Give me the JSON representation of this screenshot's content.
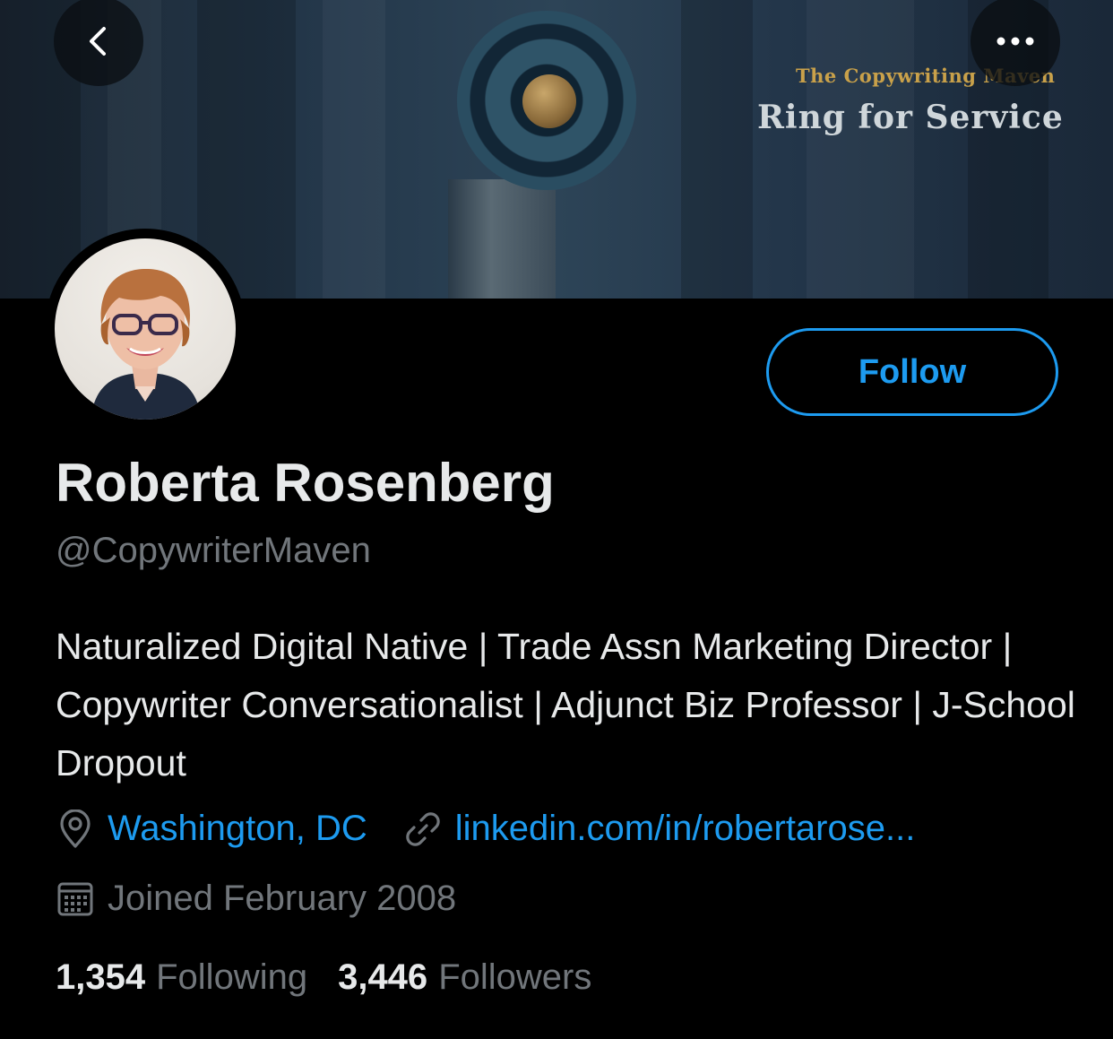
{
  "banner": {
    "subtitle": "The Copywriting Maven",
    "title": "Ring for Service"
  },
  "nav": {
    "back_icon": "chevron-left-icon",
    "more_icon": "more-horizontal-icon"
  },
  "profile": {
    "display_name": "Roberta Rosenberg",
    "handle": "@CopywriterMaven",
    "bio": "Naturalized Digital Native | Trade Assn Marketing Director | Copywriter Conversationalist | Adjunct Biz Professor | J-School Dropout",
    "location": "Washington, DC",
    "website": "linkedin.com/in/robertarose...",
    "joined": "Joined February 2008"
  },
  "actions": {
    "follow_label": "Follow"
  },
  "stats": {
    "following_count": "1,354",
    "following_label": "Following",
    "followers_count": "3,446",
    "followers_label": "Followers"
  },
  "colors": {
    "accent": "#1d9bf0",
    "background": "#000000",
    "text_primary": "#e7e9ea",
    "text_secondary": "#71767b"
  }
}
